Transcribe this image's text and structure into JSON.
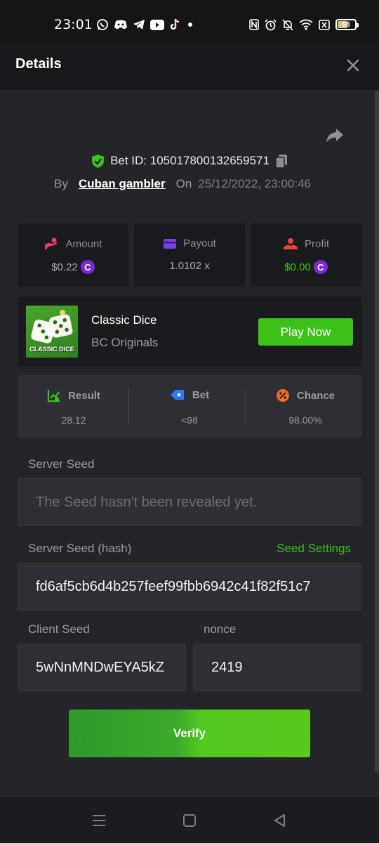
{
  "status": {
    "time": "23:01",
    "battery": 58,
    "app_icons": [
      "whatsapp-icon",
      "discord-icon",
      "telegram-icon",
      "youtube-icon",
      "tiktok-icon",
      "dot-icon"
    ],
    "system_icons": [
      "nfc-icon",
      "alarm-icon",
      "mute-icon",
      "wifi-icon",
      "sim-icon",
      "battery-icon"
    ]
  },
  "header": {
    "title": "Details"
  },
  "bet": {
    "id_label": "Bet ID: 105017800132659571",
    "by_label": "By",
    "username": "Cuban gambler",
    "on_label": "On",
    "date": "25/12/2022, 23:00:46"
  },
  "stats": {
    "amount_label": "Amount",
    "amount_value": "$0.22",
    "payout_label": "Payout",
    "payout_value": "1.0102 x",
    "profit_label": "Profit",
    "profit_value": "$0.00",
    "coin_symbol": "C"
  },
  "game": {
    "name": "Classic Dice",
    "provider": "BC Originals",
    "thumb_label": "CLASSIC DICE",
    "play_label": "Play Now"
  },
  "result": {
    "result_label": "Result",
    "result_value": "28.12",
    "bet_label": "Bet",
    "bet_value": "<98",
    "chance_label": "Chance",
    "chance_value": "98.00%"
  },
  "seeds": {
    "server_seed_label": "Server Seed",
    "server_seed_placeholder": "The Seed hasn't been revealed yet.",
    "server_hash_label": "Server Seed (hash)",
    "seed_settings_label": "Seed Settings",
    "server_hash_value": "fd6af5cb6d4b257feef99fbb6942c41f82f51c7",
    "client_seed_label": "Client Seed",
    "client_seed_value": "5wNnMNDwEYA5kZ",
    "nonce_label": "nonce",
    "nonce_value": "2419"
  },
  "verify_label": "Verify",
  "colors": {
    "accent_green": "#3bc117",
    "coin_purple": "#7a28d8",
    "background": "#232529",
    "card": "#1a1b1e"
  }
}
